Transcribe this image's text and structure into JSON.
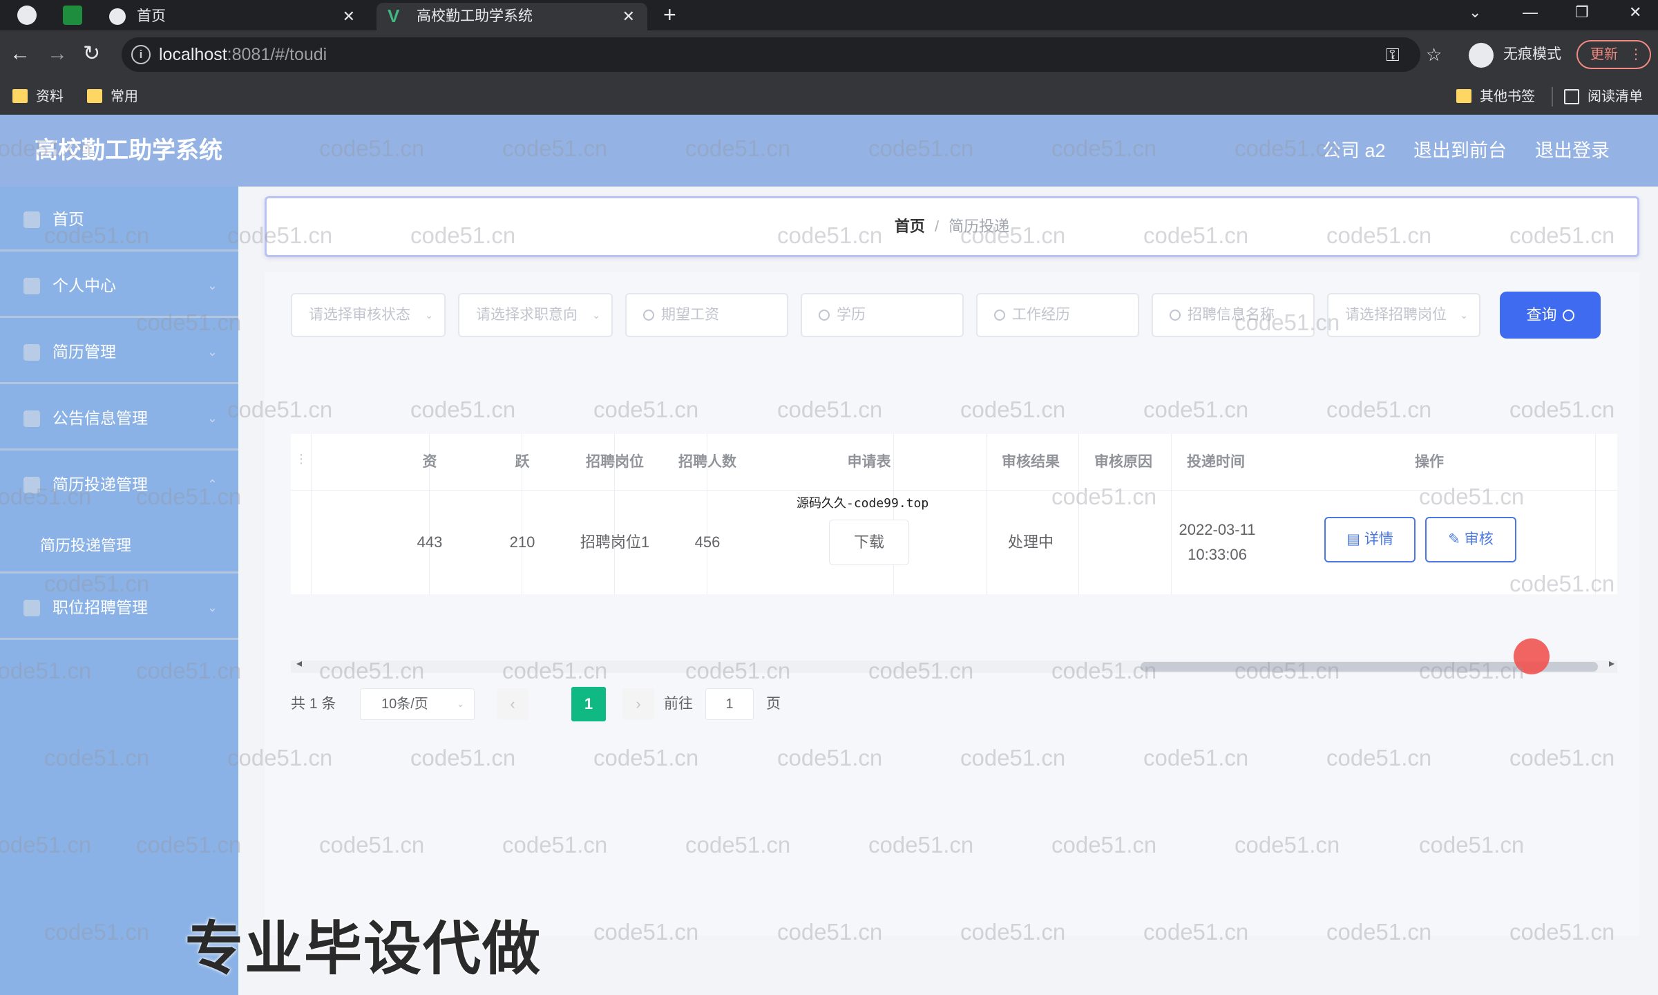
{
  "browser": {
    "tabs": [
      {
        "title": "首页"
      },
      {
        "title": "高校勤工助学系统"
      }
    ],
    "url_host": "localhost",
    "url_rest": ":8081/#/toudi",
    "incognito_label": "无痕模式",
    "update_label": "更新",
    "bookmarks_left": [
      "资料",
      "常用"
    ],
    "bookmarks_right": [
      "其他书签",
      "阅读清单"
    ]
  },
  "header": {
    "title": "高校勤工助学系统",
    "user": "公司 a2",
    "back_front": "退出到前台",
    "logout": "退出登录"
  },
  "sidebar": {
    "items": [
      {
        "label": "首页"
      },
      {
        "label": "个人中心"
      },
      {
        "label": "简历管理"
      },
      {
        "label": "公告信息管理"
      },
      {
        "label": "简历投递管理"
      }
    ],
    "sub_item": "简历投递管理",
    "last_item": "职位招聘管理"
  },
  "breadcrumb": {
    "home": "首页",
    "separator": "/",
    "current": "简历投递"
  },
  "filters": {
    "f1": "请选择审核状态",
    "f2": "请选择求职意向",
    "f3": "期望工资",
    "f4": "学历",
    "f5": "工作经历",
    "f6": "招聘信息名称",
    "f7": "请选择招聘岗位",
    "query": "查询"
  },
  "table": {
    "headers": [
      "资",
      "跃",
      "招聘岗位",
      "招聘人数",
      "申请表",
      "审核结果",
      "审核原因",
      "投递时间",
      "操作"
    ],
    "row": {
      "c1": "443",
      "c2": "210",
      "position": "招聘岗位1",
      "headcount": "456",
      "download": "下载",
      "result": "处理中",
      "reason": "",
      "time": "2022-03-11 10:33:06",
      "detail": "详情",
      "audit": "审核"
    }
  },
  "pagination": {
    "total": "共 1 条",
    "page_size": "10条/页",
    "current_page": "1",
    "goto_label": "前往",
    "goto_value": "1",
    "page_suffix": "页"
  },
  "overlay_text": "源码久久-code99.top",
  "promo_text": "专业毕设代做",
  "watermark_text": "code51.cn"
}
